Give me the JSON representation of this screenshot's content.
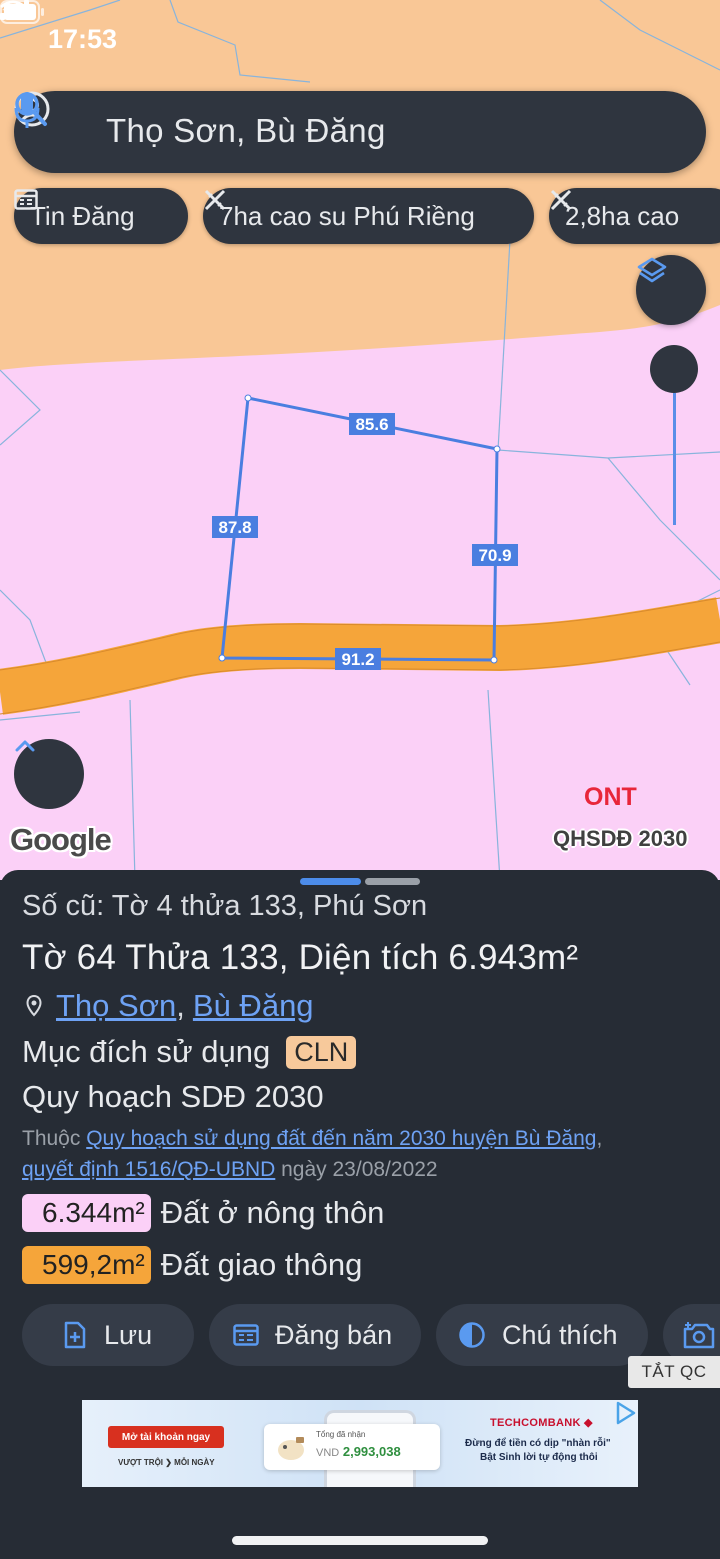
{
  "status_bar": {
    "time": "17:53"
  },
  "search": {
    "query": "Thọ Sơn, Bù Đăng"
  },
  "chips": [
    {
      "label": "Tin Đăng",
      "icon": "calendar-icon"
    },
    {
      "label": "7ha cao su Phú Riềng",
      "icon": "measure-icon"
    },
    {
      "label": "2,8ha cao",
      "icon": "measure-icon"
    }
  ],
  "map": {
    "edge_labels": {
      "top": "85.6",
      "left": "87.8",
      "right": "70.9",
      "bottom": "91.2"
    },
    "zone_label": "ONT",
    "plan_label": "QHSDĐ 2030",
    "logo": "Google",
    "colors": {
      "residential": "#fbd0f7",
      "agricultural": "#f9c796",
      "road": "#f5a53a",
      "parcel": "#4a7ee0"
    }
  },
  "sheet": {
    "old_number": "Số cũ: Tờ 4 thửa 133, Phú Sơn",
    "title": "Tờ 64 Thửa 133, Diện tích 6.943m²",
    "address": {
      "commune": "Thọ Sơn",
      "sep": ",",
      "district": "Bù Đăng"
    },
    "purpose_label": "Mục đích sử dụng",
    "purpose_code": "CLN",
    "plan_title": "Quy hoạch SDĐ 2030",
    "belongs_prefix": "Thuộc",
    "belongs_link": "Quy hoạch sử dụng đất đến năm 2030 huyện Bù Đăng",
    "belongs_comma": ",",
    "decision_link": "quyết định 1516/QĐ-UBND",
    "decision_date": " ngày 23/08/2022",
    "areas": [
      {
        "value": "6.344m²",
        "label": "Đất ở nông thôn",
        "color": "#fbd0f7"
      },
      {
        "value": "599,2m²",
        "label": "Đất giao thông",
        "color": "#f5a53a"
      }
    ]
  },
  "actions": [
    {
      "label": "Lưu",
      "icon": "save-doc-icon"
    },
    {
      "label": "Đăng bán",
      "icon": "calendar-icon"
    },
    {
      "label": "Chú thích",
      "icon": "contrast-icon"
    },
    {
      "label": "",
      "icon": "camera-add-icon"
    }
  ],
  "ad": {
    "close_label": "TẮT QC",
    "cta": "Mở tài khoản ngay",
    "cta_sub": "VƯỢT TRỘI ❯ MỖI NGÀY",
    "card_caption": "Tổng đã nhận",
    "card_currency": "VND",
    "card_value": "2,993,038",
    "brand": "TECHCOMBANK",
    "slogan_1": "Đừng để tiền có dịp \"nhàn rỗi\"",
    "slogan_2": "Bật Sinh lời tự động thôi"
  }
}
